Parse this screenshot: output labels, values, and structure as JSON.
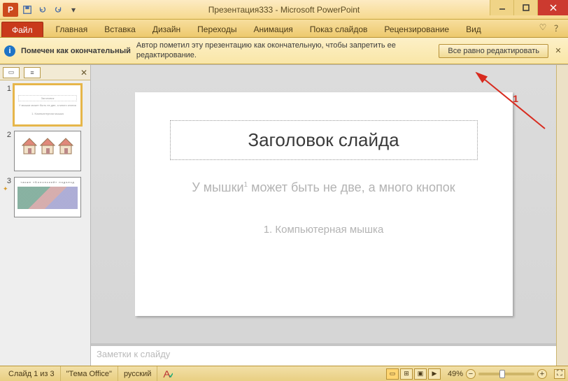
{
  "titlebar": {
    "app_logo_letter": "P",
    "title": "Презентация333 - Microsoft PowerPoint"
  },
  "ribbon": {
    "file": "Файл",
    "tabs": [
      "Главная",
      "Вставка",
      "Дизайн",
      "Переходы",
      "Анимация",
      "Показ слайдов",
      "Рецензирование",
      "Вид"
    ]
  },
  "infobar": {
    "title": "Помечен как окончательный",
    "message": "Автор пометил эту презентацию как окончательную, чтобы запретить ее редактирование.",
    "button": "Все равно редактировать"
  },
  "thumbs": {
    "items": [
      {
        "num": "1",
        "selected": true
      },
      {
        "num": "2",
        "selected": false
      },
      {
        "num": "3",
        "selected": false
      }
    ]
  },
  "slide": {
    "title": "Заголовок слайда",
    "subtitle_pre": "У мышки",
    "subtitle_sup": "1",
    "subtitle_post": " может быть не две, а много кнопок",
    "footnote": "1. Компьютерная мышка"
  },
  "notes": {
    "placeholder": "Заметки к слайду"
  },
  "status": {
    "slide_count": "Слайд 1 из 3",
    "theme": "\"Тема Office\"",
    "language": "русский",
    "zoom": "49%"
  },
  "annotation": {
    "label": "1"
  }
}
